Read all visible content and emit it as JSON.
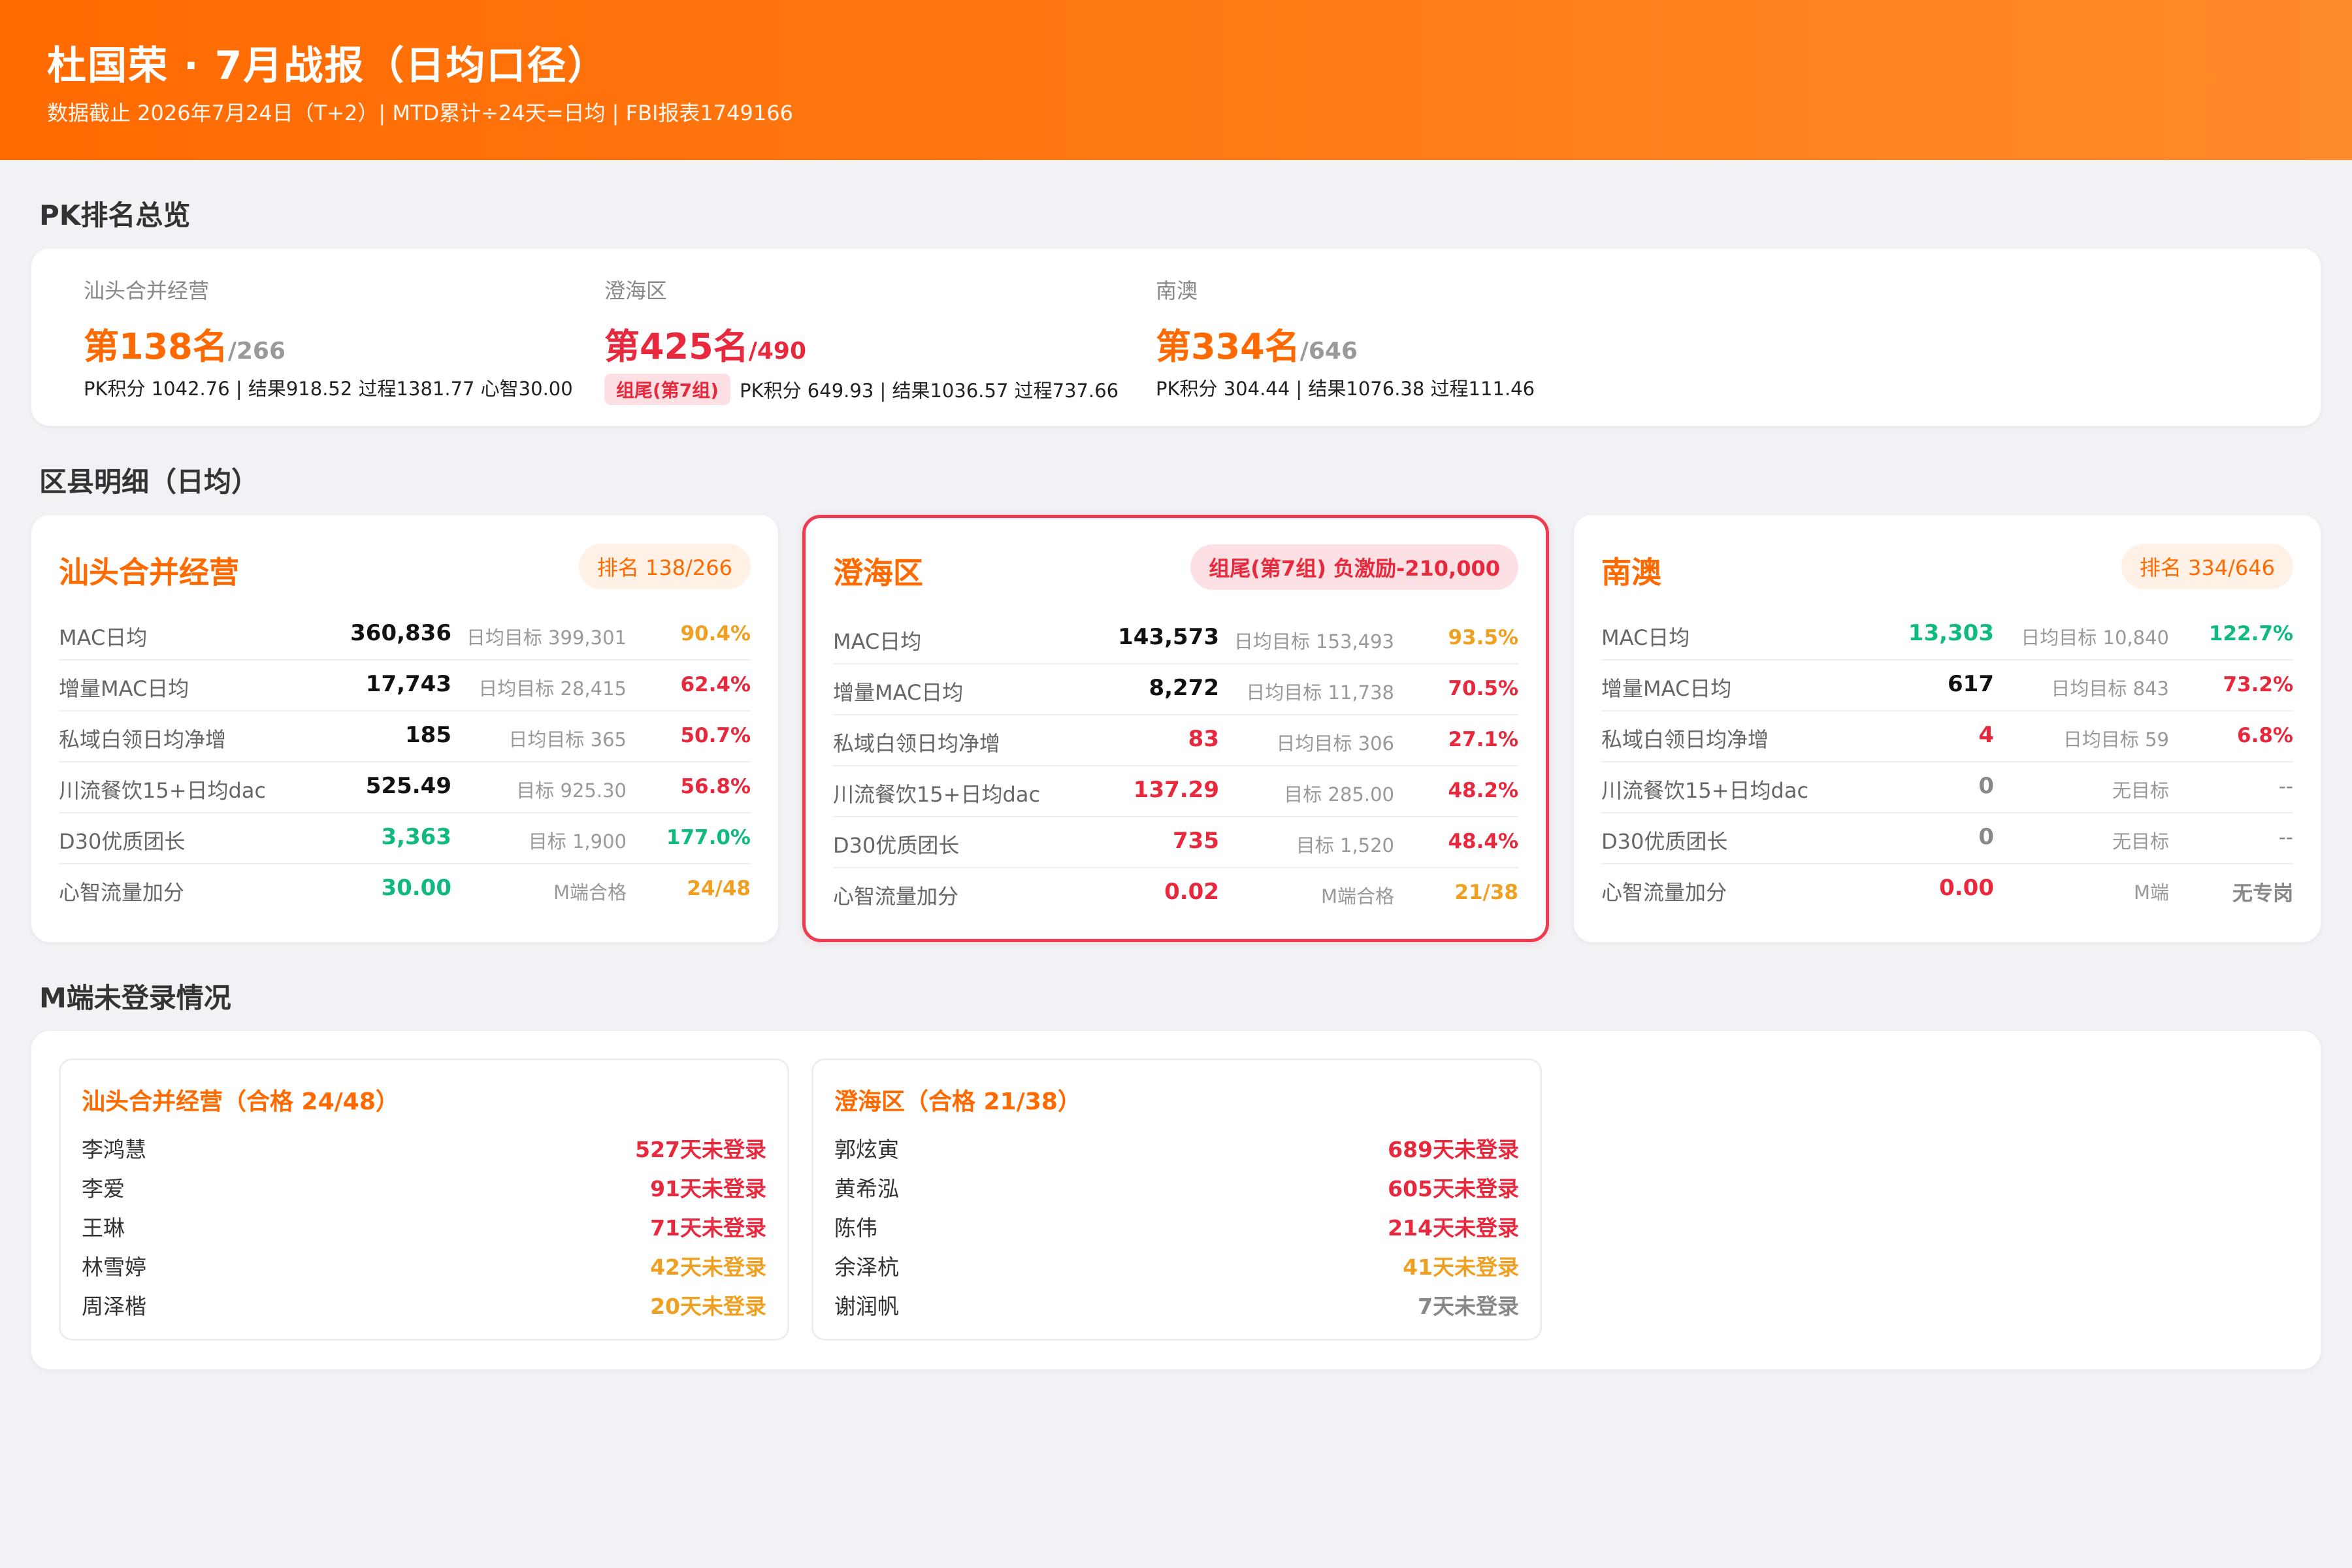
{
  "header": {
    "title": "杜国荣 · 7月战报（日均口径）",
    "subtitle": "数据截止 2026年7月24日（T+2）| MTD累计÷24天=日均 | FBI报表1749166"
  },
  "sections": {
    "pk_overview": "PK排名总览",
    "district_detail": "区县明细（日均）",
    "m_login": "M端未登录情况"
  },
  "colors": {
    "orange": "#ff6a00",
    "red": "#e8283c",
    "green": "#10b981",
    "amber": "#f0a020",
    "gray": "#888888"
  },
  "pk": [
    {
      "name": "汕头合并经营",
      "rank": "第138名",
      "total": "/266",
      "tag": "",
      "detail": "PK积分 1042.76 | 结果918.52 过程1381.77 心智30.00"
    },
    {
      "name": "澄海区",
      "rank": "第425名",
      "total": "/490",
      "tag": "组尾(第7组)",
      "detail": "PK积分 649.93 | 结果1036.57 过程737.66"
    },
    {
      "name": "南澳",
      "rank": "第334名",
      "total": "/646",
      "tag": "",
      "detail": "PK积分 304.44 | 结果1076.38 过程111.46"
    }
  ],
  "districts": [
    {
      "name": "汕头合并经营",
      "badge": "排名 138/266",
      "rows": [
        {
          "label": "MAC日均",
          "value": "360,836",
          "target": "日均目标 399,301",
          "pct": "90.4%"
        },
        {
          "label": "增量MAC日均",
          "value": "17,743",
          "target": "日均目标 28,415",
          "pct": "62.4%"
        },
        {
          "label": "私域白领日均净增",
          "value": "185",
          "target": "日均目标 365",
          "pct": "50.7%"
        },
        {
          "label": "川流餐饮15+日均dac",
          "value": "525.49",
          "target": "目标 925.30",
          "pct": "56.8%"
        },
        {
          "label": "D30优质团长",
          "value": "3,363",
          "target": "目标 1,900",
          "pct": "177.0%"
        },
        {
          "label": "心智流量加分",
          "value": "30.00",
          "target": "M端合格",
          "pct": "24/48"
        }
      ]
    },
    {
      "name": "澄海区",
      "badge": "组尾(第7组) 负激励-210,000",
      "rows": [
        {
          "label": "MAC日均",
          "value": "143,573",
          "target": "日均目标 153,493",
          "pct": "93.5%"
        },
        {
          "label": "增量MAC日均",
          "value": "8,272",
          "target": "日均目标 11,738",
          "pct": "70.5%"
        },
        {
          "label": "私域白领日均净增",
          "value": "83",
          "target": "日均目标 306",
          "pct": "27.1%"
        },
        {
          "label": "川流餐饮15+日均dac",
          "value": "137.29",
          "target": "目标 285.00",
          "pct": "48.2%"
        },
        {
          "label": "D30优质团长",
          "value": "735",
          "target": "目标 1,520",
          "pct": "48.4%"
        },
        {
          "label": "心智流量加分",
          "value": "0.02",
          "target": "M端合格",
          "pct": "21/38"
        }
      ]
    },
    {
      "name": "南澳",
      "badge": "排名 334/646",
      "rows": [
        {
          "label": "MAC日均",
          "value": "13,303",
          "target": "日均目标 10,840",
          "pct": "122.7%"
        },
        {
          "label": "增量MAC日均",
          "value": "617",
          "target": "日均目标 843",
          "pct": "73.2%"
        },
        {
          "label": "私域白领日均净增",
          "value": "4",
          "target": "日均目标 59",
          "pct": "6.8%"
        },
        {
          "label": "川流餐饮15+日均dac",
          "value": "0",
          "target": "无目标",
          "pct": "--"
        },
        {
          "label": "D30优质团长",
          "value": "0",
          "target": "无目标",
          "pct": "--"
        },
        {
          "label": "心智流量加分",
          "value": "0.00",
          "target": "M端",
          "pct": "无专岗"
        }
      ]
    }
  ],
  "login_panels": [
    {
      "title": "汕头合并经营（合格 24/48）",
      "users": [
        {
          "name": "李鸿慧",
          "days": "527天未登录"
        },
        {
          "name": "李爱",
          "days": "91天未登录"
        },
        {
          "name": "王琳",
          "days": "71天未登录"
        },
        {
          "name": "林雪婷",
          "days": "42天未登录"
        },
        {
          "name": "周泽楷",
          "days": "20天未登录"
        }
      ]
    },
    {
      "title": "澄海区（合格 21/38）",
      "users": [
        {
          "name": "郭炫寅",
          "days": "689天未登录"
        },
        {
          "name": "黄希泓",
          "days": "605天未登录"
        },
        {
          "name": "陈伟",
          "days": "214天未登录"
        },
        {
          "name": "余泽杭",
          "days": "41天未登录"
        },
        {
          "name": "谢润帆",
          "days": "7天未登录"
        }
      ]
    }
  ]
}
